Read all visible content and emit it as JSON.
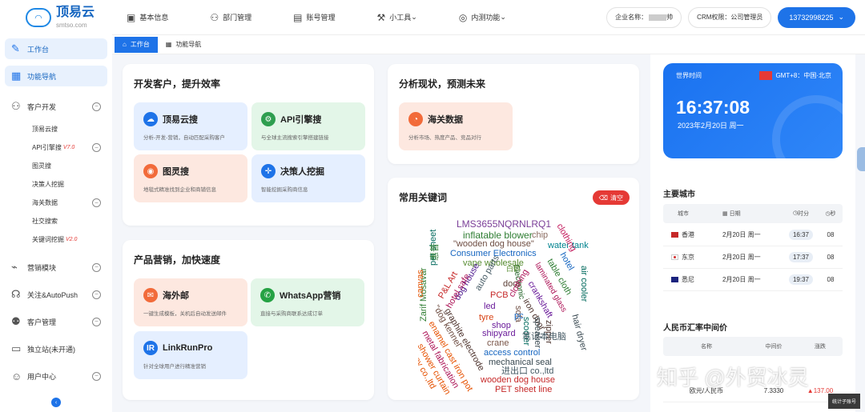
{
  "brand": {
    "name": "顶易云",
    "domain": "smtso.com"
  },
  "topnav": [
    {
      "label": "基本信息",
      "icon": "profile-icon"
    },
    {
      "label": "部门管理",
      "icon": "users-icon"
    },
    {
      "label": "账号管理",
      "icon": "account-icon"
    },
    {
      "label": "小工具",
      "icon": "tools-icon"
    },
    {
      "label": "内测功能",
      "icon": "lab-icon"
    }
  ],
  "company": {
    "label": "企业名称：",
    "value": "帅"
  },
  "crm": {
    "label": "CRM权限：",
    "value": "公司管理员"
  },
  "phone": "13732998225",
  "sidebar": {
    "workbench": "工作台",
    "nav": "功能导航",
    "customer_dev": "客户开发",
    "sub": {
      "s1": "顶易云搜",
      "s2": "API引擎搜",
      "s2_badge": "V7.0",
      "s3": "图灵搜",
      "s4": "决策人挖掘",
      "s5": "海关数据",
      "s6": "社交搜索",
      "s7": "关键词挖掘",
      "s7_badge": "V2.0"
    },
    "marketing": "营销模块",
    "autopush": "关注&AutoPush",
    "crm": "客户管理",
    "site": "独立站(未开通)",
    "user": "用户中心"
  },
  "tabs": {
    "workbench": "工作台",
    "nav": "功能导航"
  },
  "card1": {
    "title": "开发客户，提升效率",
    "f1": {
      "name": "顶易云搜",
      "desc": "分析-开发-营销，自动匹配采购客户"
    },
    "f2": {
      "name": "API引擎搜",
      "desc": "与全球主流搜索引擎搭建链接"
    },
    "f3": {
      "name": "图灵搜",
      "desc": "地毯式精准找到企业和商铺信息"
    },
    "f4": {
      "name": "决策人挖掘",
      "desc": "智能挖掘采购商信息"
    }
  },
  "card2": {
    "title": "分析现状，预测未来",
    "f1": {
      "name": "海关数据",
      "desc": "分析市场、热度产品、竞品对行"
    }
  },
  "card3": {
    "title": "产品营销，加快速度",
    "f1": {
      "name": "海外邮",
      "desc": "一键生成模板，关机后自动发送邮件"
    },
    "f2": {
      "name": "WhatsApp营销",
      "desc": "直接与采购商联系达成订单"
    },
    "f3": {
      "name": "LinkRunPro",
      "desc": "针对全球用户进行精准营销"
    }
  },
  "card4": {
    "title": "常用关键词",
    "clear": "清空",
    "words": [
      "LMS3655NQRNLRQ1",
      "inflatable blower",
      "\"wooden dog house\"",
      "Consumer Electronics",
      "vape wholesale",
      "water tank",
      "chip",
      "clothing",
      "hotel",
      "table cloth",
      "laminated glass",
      "crankshaft",
      "iron door",
      "air cooler",
      "hair dryer",
      "Electronic",
      "PCB",
      "led",
      "auto parts",
      "door",
      "clothing",
      "dog house",
      "shipyard",
      "crane",
      "access control",
      "mechanical seal",
      "进出口 co.,ltd",
      "wooden dog house",
      "PET sheet line",
      "toy co.,ltd",
      "shower curtain",
      "metal fabrication",
      "enamel cast iron pot",
      "graphite electrode",
      "\"dog kennel\"",
      "Zarif Mosavar",
      "pet sheet",
      "canvas",
      "P&L Art",
      "hotel safe",
      "tyre",
      "sofa",
      "pc",
      "scooter",
      "speaker",
      "zipper",
      "shop",
      "惠普",
      "白鹤",
      "笔记本电脑",
      "steel"
    ]
  },
  "world_clock": {
    "label": "世界时间",
    "tz": "GMT+8：中国·北京",
    "time": "16:37:08",
    "date": "2023年2月20日 周一"
  },
  "cities": {
    "title": "主要城市",
    "headers": {
      "city": "城市",
      "date": "日期",
      "hour": "时分",
      "sec": "秒"
    },
    "rows": [
      {
        "name": "香港",
        "date": "2月20日 周一",
        "time": "16:37",
        "sec": "08",
        "flag": "hk-flag-icon"
      },
      {
        "name": "东京",
        "date": "2月20日 周一",
        "time": "17:37",
        "sec": "08",
        "flag": "jp-flag-icon"
      },
      {
        "name": "悉尼",
        "date": "2月20日 周一",
        "time": "19:37",
        "sec": "08",
        "flag": "au-flag-icon"
      }
    ]
  },
  "fx": {
    "title": "人民币汇率中间价",
    "headers": {
      "name": "名称",
      "mid": "中间价",
      "chg": "涨跌"
    },
    "row": {
      "name": "欧元/人民币",
      "mid": "7.3330",
      "chg": "137.00"
    }
  },
  "counter": "统计子账号",
  "watermark": "知乎 @外贸冰灵",
  "colors": {
    "primary": "#1e73e8",
    "clear_red": "#e53935"
  }
}
